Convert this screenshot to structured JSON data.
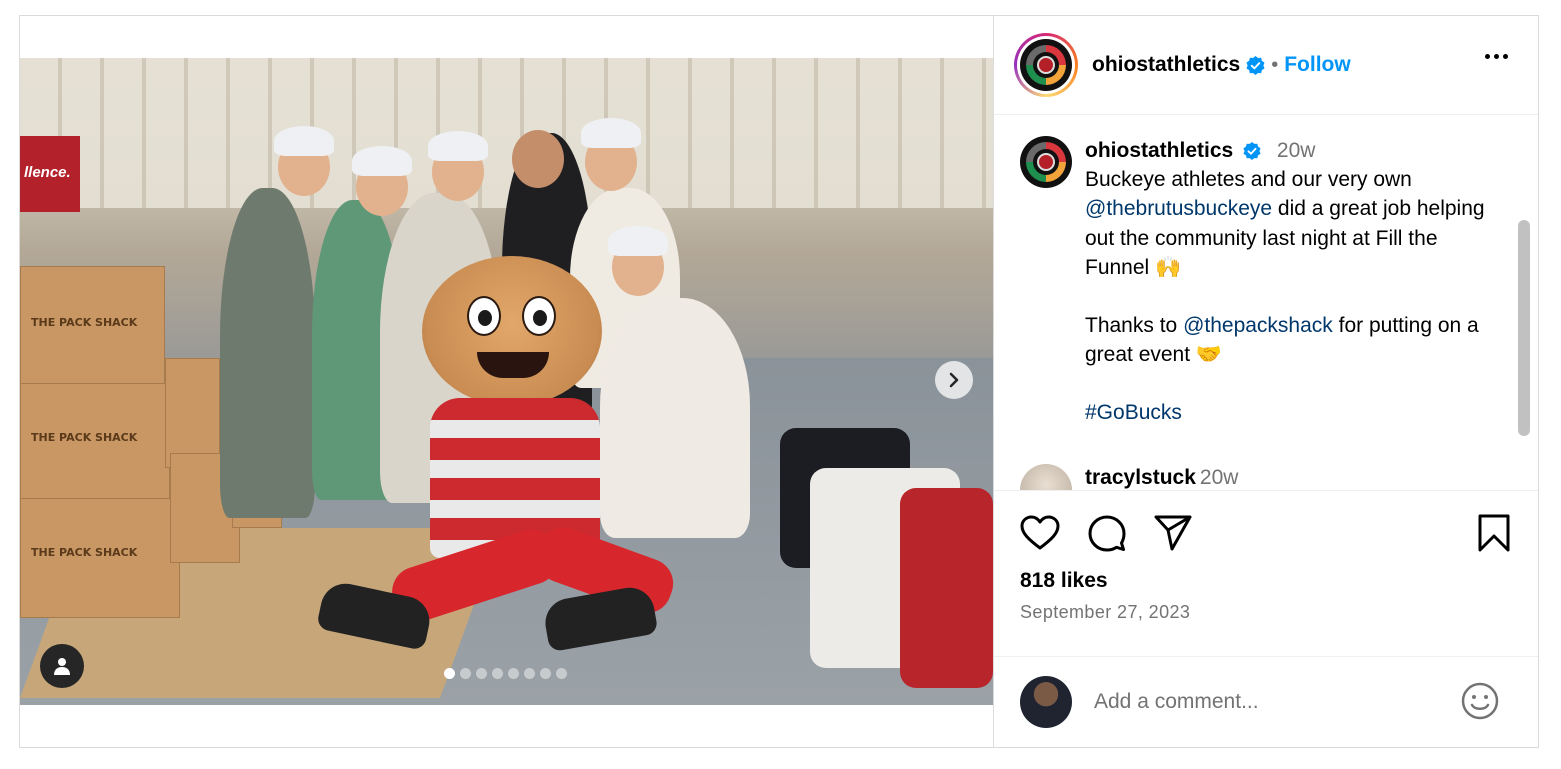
{
  "post": {
    "author": "ohiostathletics",
    "follow_label": "Follow",
    "separator": "•",
    "caption": {
      "author": "ohiostathletics",
      "time": "20w",
      "line1": "Buckeye athletes and our very own",
      "mention1": "@thebrutusbuckeye",
      "line2_rest": " did a great job helping out the community last night at Fill the Funnel 🙌",
      "thanks_prefix": "Thanks to ",
      "mention2": "@thepackshack",
      "thanks_rest": " for putting on a great event 🤝",
      "hashtag": "#GoBucks"
    },
    "next_comment": {
      "author": "tracylstuck",
      "time": "20w"
    },
    "likes": "818 likes",
    "date": "September 27, 2023",
    "comment_placeholder": "Add a comment..."
  },
  "media": {
    "banner_text": "llence.",
    "box_label": "THE PACK SHACK",
    "carousel": {
      "total": 8,
      "current": 1
    }
  },
  "icons": {
    "verified": "verified-badge-icon",
    "more": "more-options-icon",
    "like": "heart-icon",
    "comment": "comment-icon",
    "share": "share-icon",
    "save": "bookmark-icon",
    "emoji": "emoji-icon",
    "next": "chevron-right-icon",
    "tag": "user-tag-icon"
  },
  "colors": {
    "accent": "#0095f6",
    "link": "#00376b",
    "muted": "#737373",
    "border": "#dbdbdb"
  }
}
